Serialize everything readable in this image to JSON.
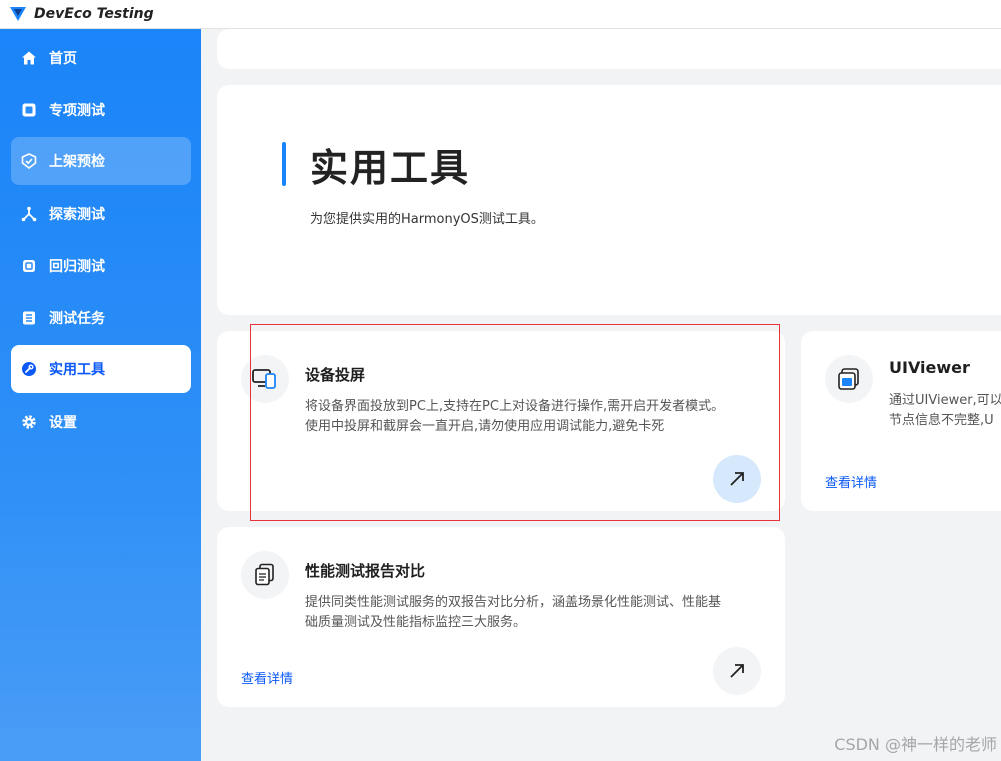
{
  "app": {
    "title": "DevEco Testing"
  },
  "sidebar": {
    "items": [
      {
        "label": "首页",
        "icon": "home-icon"
      },
      {
        "label": "专项测试",
        "icon": "square-icon"
      },
      {
        "label": "上架预检",
        "icon": "shield-check-icon"
      },
      {
        "label": "探索测试",
        "icon": "network-icon"
      },
      {
        "label": "回归测试",
        "icon": "copy-icon"
      },
      {
        "label": "测试任务",
        "icon": "list-icon"
      },
      {
        "label": "实用工具",
        "icon": "wrench-icon"
      },
      {
        "label": "设置",
        "icon": "gear-icon"
      }
    ],
    "active_index": 6,
    "hover_index": 2
  },
  "header": {
    "title": "实用工具",
    "subtitle": "为您提供实用的HarmonyOS测试工具。"
  },
  "cards": [
    {
      "title": "设备投屏",
      "desc_line1": "将设备界面投放到PC上,支持在PC上对设备进行操作,需开启开发者模式。",
      "desc_line2": "使用中投屏和截屏会一直开启,请勿使用应用调试能力,避免卡死",
      "icon": "screen-cast-icon"
    },
    {
      "title": "UIViewer",
      "desc_line1": "通过UIViewer,可以",
      "desc_line2": "节点信息不完整,U",
      "link": "查看详情",
      "icon": "ui-window-icon"
    },
    {
      "title": "性能测试报告对比",
      "desc_line1": "提供同类性能测试服务的双报告对比分析，涵盖场景化性能测试、性能基",
      "desc_line2": "础质量测试及性能指标监控三大服务。",
      "link": "查看详情",
      "icon": "report-compare-icon"
    }
  ],
  "watermark": "CSDN @神一样的老师",
  "colors": {
    "accent": "#1a84f8",
    "active_text": "#0a59f7",
    "highlight": "#e8323c"
  }
}
